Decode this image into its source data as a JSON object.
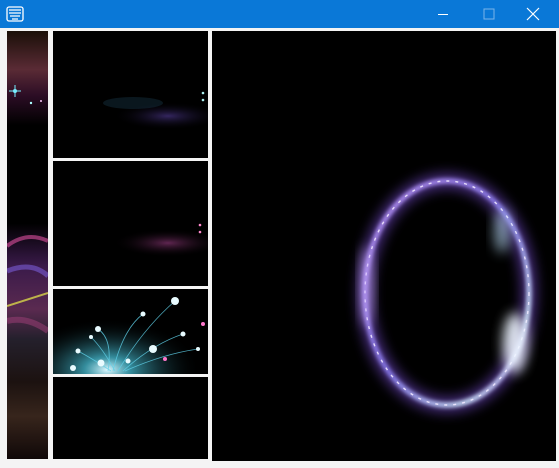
{
  "window": {
    "title": "",
    "icon": "app-logo-icon",
    "controls": [
      "minimize-icon",
      "maximize-icon",
      "close-icon"
    ],
    "accent": "#0a78d7"
  },
  "layout_panels": {
    "left_strip": "vertical-image-strip",
    "thumbnails": [
      "blurred-light-1",
      "blurred-light-2",
      "fireworks-burst",
      "blank"
    ],
    "preview": "glowing-ring"
  },
  "colors": {
    "background": "#000000",
    "ring_violet": "#b77cff",
    "ring_cyan": "#9fdcff"
  }
}
